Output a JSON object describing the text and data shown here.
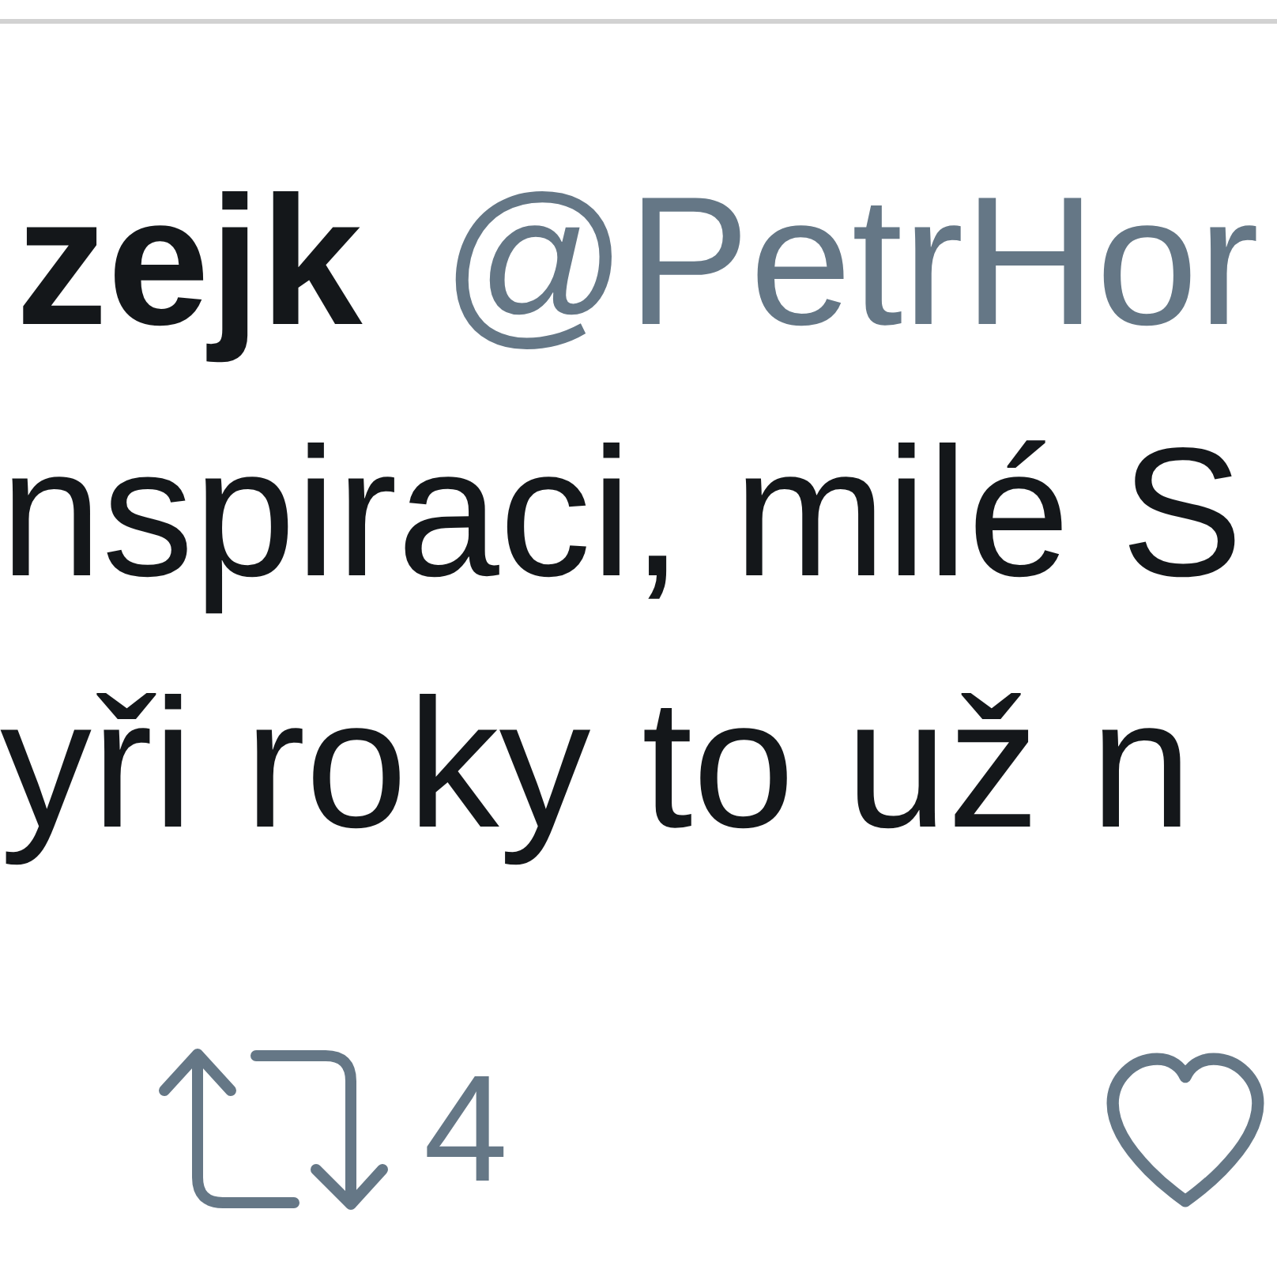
{
  "tweet": {
    "author_name": "zejk",
    "handle": "@PetrHor",
    "text_lines": [
      "nspiraci, milé S",
      "yři roky to už n"
    ],
    "actions": [
      {
        "kind": "retweet",
        "count": "4"
      },
      {
        "kind": "like"
      }
    ]
  }
}
